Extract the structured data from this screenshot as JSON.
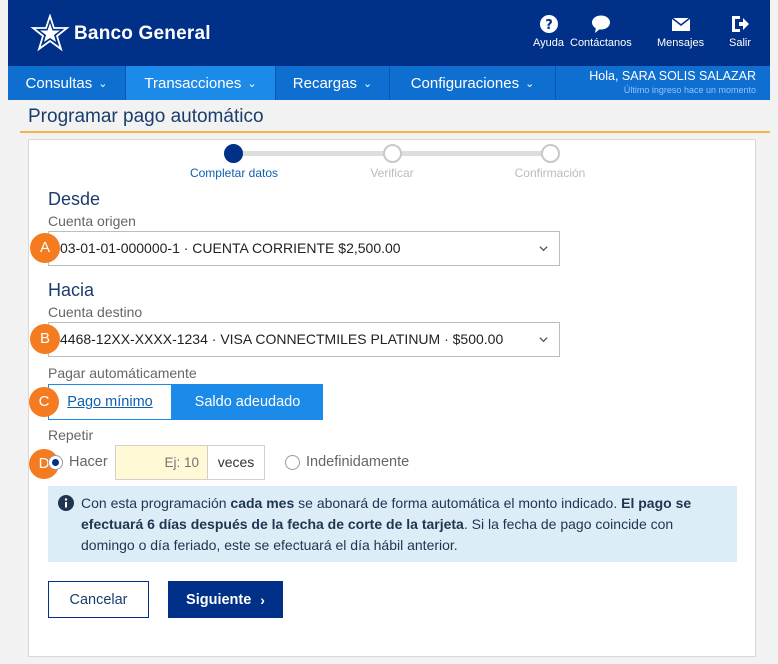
{
  "header": {
    "brand": "Banco General",
    "actions": [
      {
        "label": "Ayuda",
        "icon": "help-icon"
      },
      {
        "label": "Contáctanos",
        "icon": "chat-icon"
      },
      {
        "label": "Mensajes",
        "icon": "mail-icon"
      },
      {
        "label": "Salir",
        "icon": "logout-icon"
      }
    ]
  },
  "nav": {
    "items": [
      {
        "label": "Consultas",
        "active": false
      },
      {
        "label": "Transacciones",
        "active": true
      },
      {
        "label": "Recargas",
        "active": false
      },
      {
        "label": "Configuraciones",
        "active": false
      }
    ],
    "user_greeting": "Hola, SARA SOLIS SALAZAR",
    "last_login": "Último ingreso hace un momento"
  },
  "page": {
    "title": "Programar pago automático"
  },
  "stepper": {
    "steps": [
      "Completar datos",
      "Verificar",
      "Confirmación"
    ],
    "current": 0
  },
  "form": {
    "from_heading": "Desde",
    "origin_label": "Cuenta origen",
    "origin_value": "03-01-01-000000-1 · CUENTA CORRIENTE $2,500.00",
    "to_heading": "Hacia",
    "dest_label": "Cuenta destino",
    "dest_value": "4468-12XX-XXXX-1234 · VISA CONNECTMILES PLATINUM · $500.00",
    "auto_pay_label": "Pagar automáticamente",
    "auto_pay_options": [
      "Pago mínimo",
      "Saldo adeudado"
    ],
    "auto_pay_selected": "Saldo adeudado",
    "repeat_label": "Repetir",
    "repeat_do_label": "Hacer",
    "repeat_times_placeholder": "Ej: 10",
    "repeat_times_unit": "veces",
    "repeat_indefinite_label": "Indefinidamente",
    "repeat_selected": "Hacer"
  },
  "badges": [
    "A",
    "B",
    "C",
    "D"
  ],
  "info": {
    "t1": "Con esta programación ",
    "b1": "cada mes",
    "t2": " se abonará de forma automática el monto indicado. ",
    "b2": "El pago se efectuará 6 días después de la fecha de corte de la tarjeta",
    "t3": ". Si la fecha de pago coincide con domingo o día feriado, este se efectuará el día hábil anterior."
  },
  "buttons": {
    "cancel": "Cancelar",
    "next": "Siguiente"
  },
  "colors": {
    "header_bg": "#003087",
    "nav_bg": "#0f6fd1",
    "nav_active": "#1b8ae8",
    "badge": "#f47b20",
    "title_rule": "#f2b64a",
    "info_bg": "#dcedf8"
  }
}
